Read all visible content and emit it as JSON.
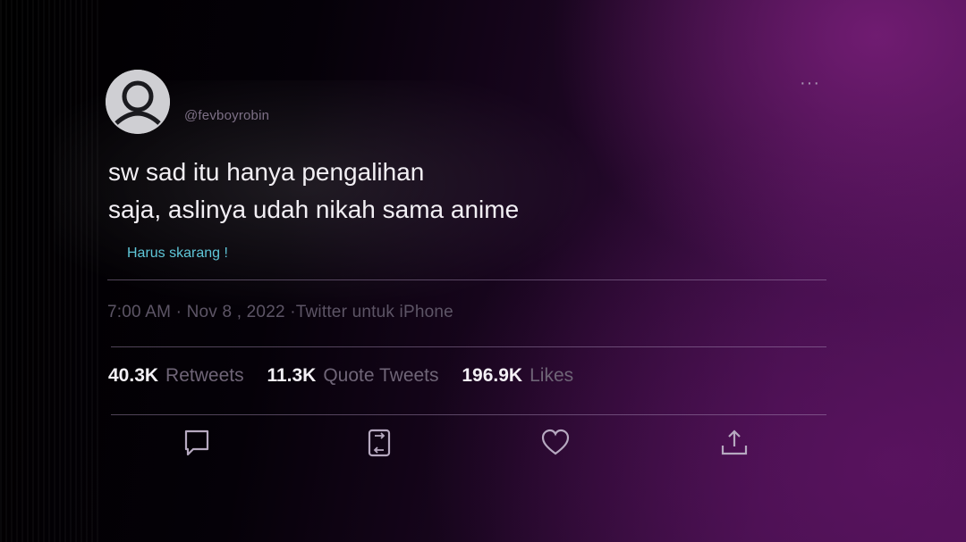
{
  "tweet": {
    "handle": "@fevboyrobin",
    "text_lines": [
      "sw sad itu hanya pengalihan",
      "saja, aslinya udah nikah sama anime"
    ],
    "link_text": "Harus skarang !",
    "timestamp": "7:00 AM · Nov 8 , 2022 ·Twitter untuk iPhone",
    "more_label": "···"
  },
  "stats": [
    {
      "value": "40.3K",
      "label": "Retweets"
    },
    {
      "value": "11.3K",
      "label": "Quote Tweets"
    },
    {
      "value": "196.9K",
      "label": "Likes"
    }
  ],
  "actions": [
    {
      "icon": "reply-icon"
    },
    {
      "icon": "retweet-icon"
    },
    {
      "icon": "heart-icon"
    },
    {
      "icon": "share-icon"
    }
  ],
  "colors": {
    "text": "#f2eff4",
    "link": "#5fc6d8",
    "muted": "#6f6577",
    "background_accent": "#4a1052"
  }
}
